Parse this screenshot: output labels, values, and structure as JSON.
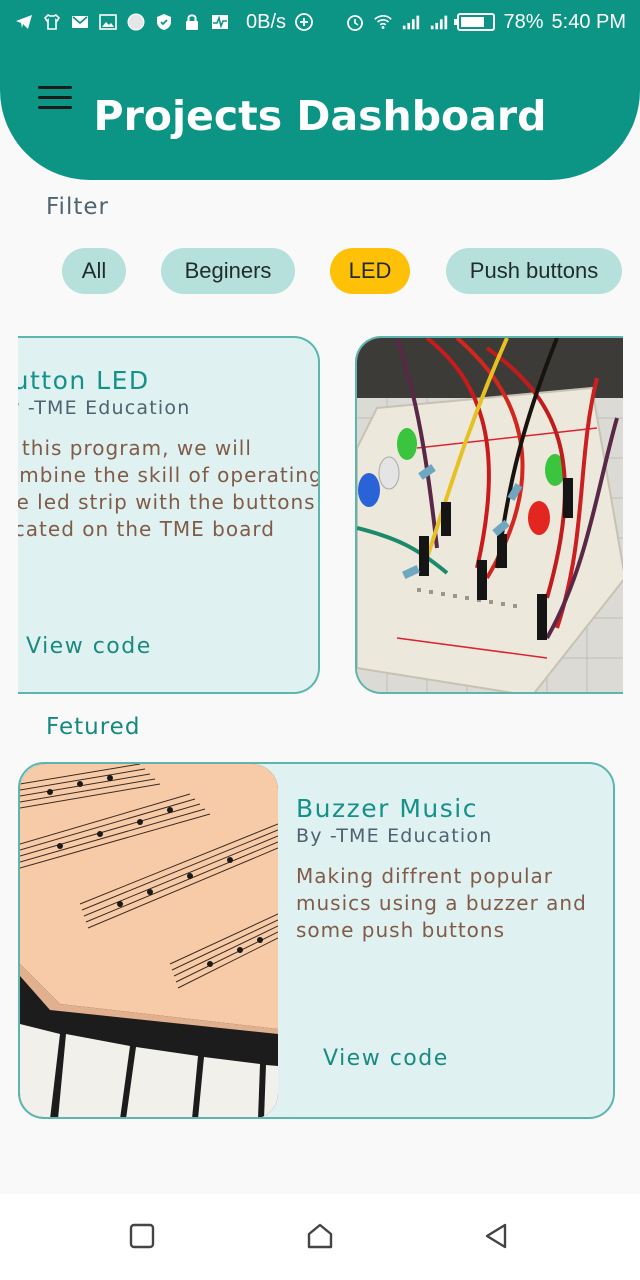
{
  "status_bar": {
    "speed": "0B/s",
    "battery": "78%",
    "battery_level": 0.78,
    "time": "5:40 PM"
  },
  "header": {
    "title": "Projects Dashboard",
    "menu_icon": "hamburger-icon"
  },
  "filter": {
    "label": "Filter",
    "chips": [
      {
        "label": "All",
        "active": false
      },
      {
        "label": "Beginers",
        "active": false
      },
      {
        "label": "LED",
        "active": true
      },
      {
        "label": "Push buttons",
        "active": false
      }
    ]
  },
  "projects": [
    {
      "title": "Button LED",
      "author": "By -TME Education",
      "description": "In this program, we will combine the skill of operating the led strip with the buttons located on the TME board",
      "action": "View code",
      "image": "breadboard-leds-photo"
    }
  ],
  "featured": {
    "label": "Fetured",
    "item": {
      "title": "Buzzer Music",
      "author": "By -TME Education",
      "description": "Making diffrent popular musics using a buzzer and some push buttons",
      "action": "View code",
      "image": "sheet-music-piano-photo"
    }
  },
  "nav": {
    "items": [
      "recent-apps-icon",
      "home-icon",
      "back-icon"
    ]
  },
  "colors": {
    "primary": "#0c9485",
    "chip": "#b6e0dc",
    "chip_active": "#ffc107",
    "card_bg": "#e0f1f1",
    "card_border": "#5cb6ad",
    "title_teal": "#14928a",
    "desc_brown": "#805c48"
  }
}
